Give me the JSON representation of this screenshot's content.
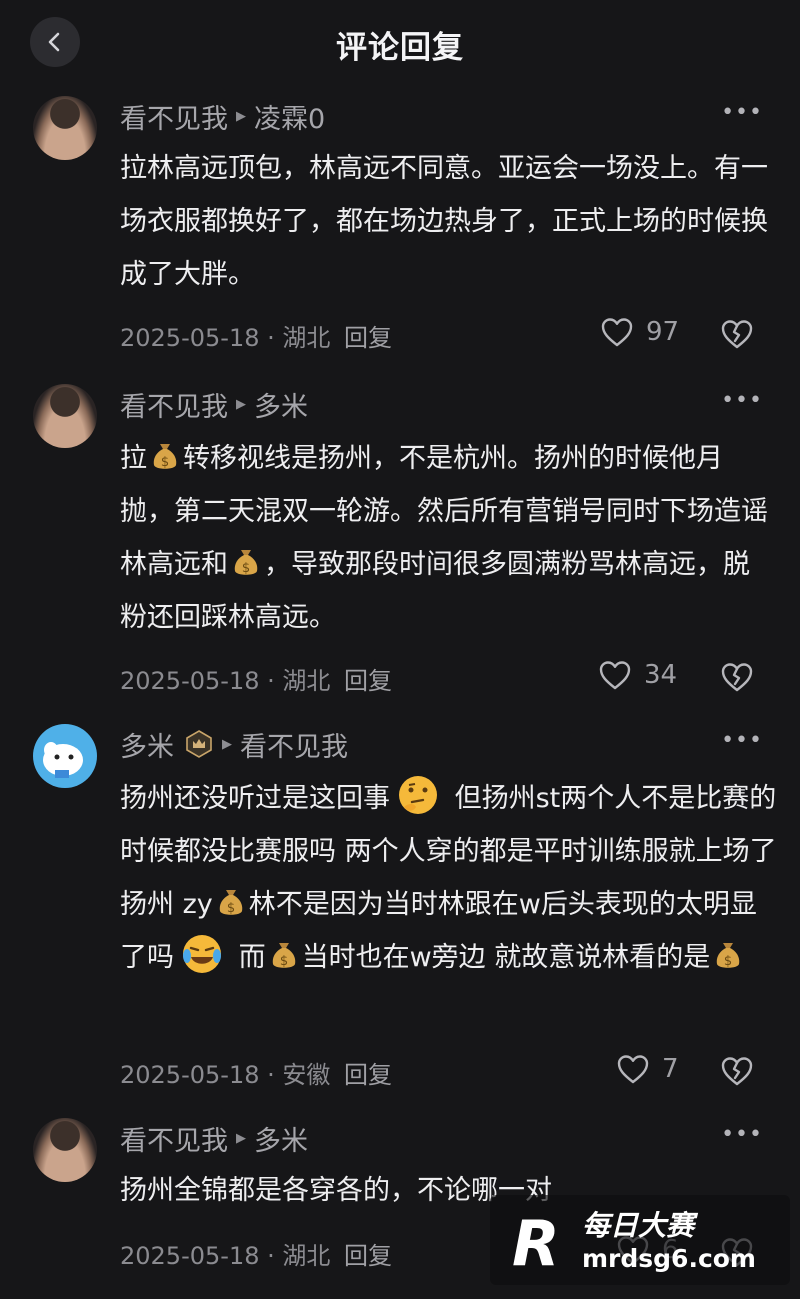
{
  "header": {
    "title": "评论回复"
  },
  "comments": [
    {
      "user": "看不见我",
      "reply_to": "凌霖0",
      "text": "拉林高远顶包，林高远不同意。亚运会一场没上。有一场衣服都换好了，都在场边热身了，正式上场的时候换成了大胖。",
      "date": "2025-05-18",
      "location": "湖北",
      "reply_label": "回复",
      "likes": "97"
    },
    {
      "user": "看不见我",
      "reply_to": "多米",
      "text_parts": [
        "拉",
        "转移视线是扬州，不是杭州。扬州的时候他月抛，第二天混双一轮游。然后所有营销号同时下场造谣林高远和",
        "，导致那段时间很多圆满粉骂林高远，脱粉还回踩林高远。"
      ],
      "date": "2025-05-18",
      "location": "湖北",
      "reply_label": "回复",
      "likes": "34"
    },
    {
      "user": "多米",
      "reply_to": "看不见我",
      "text_parts": [
        "扬州还没听过是这回事",
        " 但扬州st两个人不是比赛的时候都没比赛服吗  两个人穿的都是平时训练服就上场了  扬州 zy",
        "林不是因为当时林跟在w后头表现的太明显了吗",
        " 而",
        "当时也在w旁边   就故意说林看的是"
      ],
      "date": "2025-05-18",
      "location": "安徽",
      "reply_label": "回复",
      "likes": "7"
    },
    {
      "user": "看不见我",
      "reply_to": "多米",
      "text": "扬州全锦都是各穿各的，不论哪一对",
      "date": "2025-05-18",
      "location": "湖北",
      "reply_label": "回复",
      "likes": "6"
    }
  ],
  "icons": [
    "back-chevron-icon",
    "more-icon",
    "heart-icon",
    "broken-heart-icon",
    "money-bag-icon",
    "thinking-face-icon",
    "laughing-crying-face-icon",
    "crown-badge-icon"
  ],
  "watermark": {
    "logo_letter": "R",
    "title": "每日大赛",
    "url": "mrdsg6.com"
  },
  "colors": {
    "background": "#161618",
    "text": "#eeeef0",
    "muted": "#8b8b90"
  }
}
